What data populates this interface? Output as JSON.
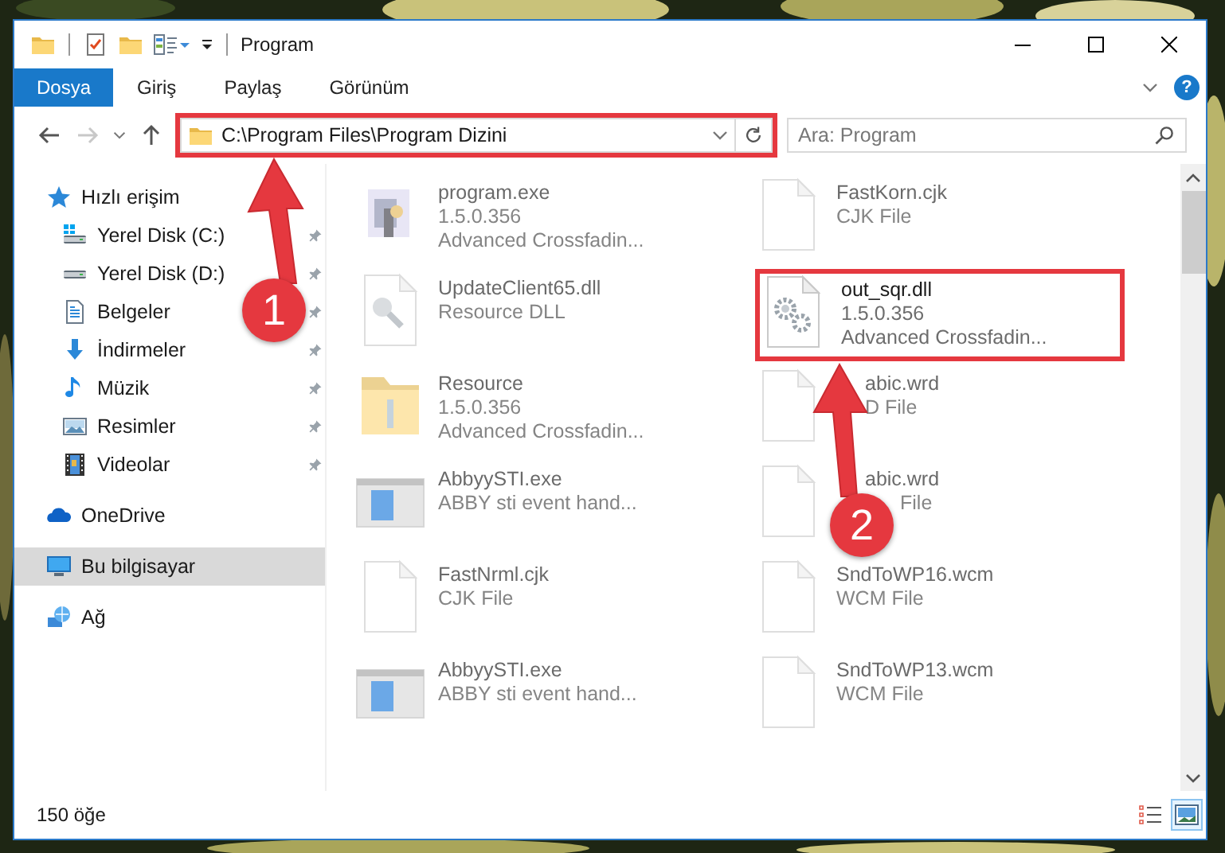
{
  "window": {
    "title": "Program"
  },
  "ribbon": {
    "tabs": [
      {
        "label": "Dosya",
        "selected": true
      },
      {
        "label": "Giriş",
        "selected": false
      },
      {
        "label": "Paylaş",
        "selected": false
      },
      {
        "label": "Görünüm",
        "selected": false
      }
    ],
    "help": "?"
  },
  "navigation": {
    "back": {
      "disabled": false
    },
    "forward": {
      "disabled": true
    }
  },
  "address_bar": {
    "path": "C:\\Program Files\\Program Dizini",
    "annotated": true
  },
  "search": {
    "placeholder": "Ara: Program"
  },
  "sidebar": {
    "items": [
      {
        "label": "Hızlı erişim",
        "kind": "star",
        "selected": false,
        "children": [
          {
            "label": "Yerel Disk (C:)",
            "kind": "drive-c",
            "pinned": true,
            "selected": false
          },
          {
            "label": "Yerel Disk (D:)",
            "kind": "drive",
            "pinned": true,
            "selected": false
          },
          {
            "label": "Belgeler",
            "kind": "documents",
            "pinned": true,
            "selected": false
          },
          {
            "label": "İndirmeler",
            "kind": "downloads",
            "pinned": true,
            "selected": false
          },
          {
            "label": "Müzik",
            "kind": "music",
            "pinned": true,
            "selected": false
          },
          {
            "label": "Resimler",
            "kind": "pictures",
            "pinned": true,
            "selected": false
          },
          {
            "label": "Videolar",
            "kind": "videos",
            "pinned": true,
            "selected": false
          }
        ]
      },
      {
        "label": "OneDrive",
        "kind": "cloud",
        "selected": false
      },
      {
        "label": "Bu bilgisayar",
        "kind": "computer",
        "selected": true
      },
      {
        "label": "Ağ",
        "kind": "network",
        "selected": false
      }
    ]
  },
  "files": [
    {
      "name": "program.exe",
      "details": [
        "1.5.0.356",
        "Advanced Crossfadin..."
      ],
      "kind": "app",
      "blurred": true,
      "annotated": false
    },
    {
      "name": "FastKorn.cjk",
      "details": [
        "CJK File"
      ],
      "kind": "blank",
      "blurred": true,
      "annotated": false
    },
    {
      "name": "UpdateClient65.dll",
      "details": [
        "Resource DLL"
      ],
      "kind": "dll",
      "blurred": true,
      "annotated": false
    },
    {
      "name": "out_sqr.dll",
      "details": [
        "1.5.0.356",
        "Advanced Crossfadin..."
      ],
      "kind": "gear-dll",
      "blurred": false,
      "annotated": true
    },
    {
      "name": "Resource",
      "details": [
        "1.5.0.356",
        "Advanced Crossfadin..."
      ],
      "kind": "folder",
      "blurred": true,
      "annotated": false
    },
    {
      "name": "abic.wrd",
      "details": [
        "D File"
      ],
      "kind": "blank",
      "blurred": true,
      "annotated": false
    },
    {
      "name": "AbbyySTI.exe",
      "details": [
        "ABBY sti event hand..."
      ],
      "kind": "window-app",
      "blurred": true,
      "annotated": false
    },
    {
      "name": "abic.wrd",
      "details": [
        "File"
      ],
      "kind": "blank",
      "blurred": true,
      "annotated": false
    },
    {
      "name": "FastNrml.cjk",
      "details": [
        "CJK File"
      ],
      "kind": "blank",
      "blurred": true,
      "annotated": false
    },
    {
      "name": "SndToWP16.wcm",
      "details": [
        "WCM File"
      ],
      "kind": "blank",
      "blurred": true,
      "annotated": false
    },
    {
      "name": "AbbyySTI.exe",
      "details": [
        "ABBY sti event hand..."
      ],
      "kind": "window-app",
      "blurred": true,
      "annotated": false
    },
    {
      "name": "SndToWP13.wcm",
      "details": [
        "WCM File"
      ],
      "kind": "blank",
      "blurred": true,
      "annotated": false
    }
  ],
  "status_bar": {
    "count": "150 öğe",
    "views": [
      {
        "kind": "details",
        "selected": false
      },
      {
        "kind": "large-icons",
        "selected": true
      }
    ]
  },
  "annotations": [
    {
      "label": "1"
    },
    {
      "label": "2"
    }
  ]
}
